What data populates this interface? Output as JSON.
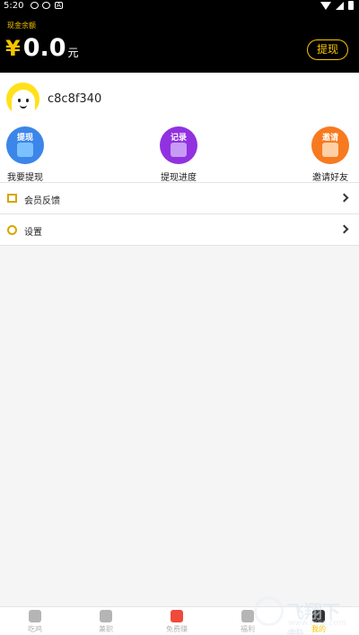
{
  "status_bar": {
    "time": "5:20",
    "notif_badge": "A"
  },
  "balance": {
    "label": "现金余额",
    "currency_symbol": "¥",
    "amount": "0.0",
    "unit": "元",
    "withdraw_label": "提现"
  },
  "profile": {
    "username": "c8c8f340"
  },
  "actions": [
    {
      "badge": "提现",
      "label": "我要提现",
      "color": "#3b86e8"
    },
    {
      "badge": "记录",
      "label": "提现进度",
      "color": "#9131e0"
    },
    {
      "badge": "邀请",
      "label": "邀请好友",
      "color": "#f77a1f"
    }
  ],
  "menu": [
    {
      "label": "会员反馈",
      "icon": "feedback-icon"
    },
    {
      "label": "设置",
      "icon": "settings-icon"
    }
  ],
  "tabs": [
    {
      "label": "吃鸡",
      "icon": "home-icon"
    },
    {
      "label": "兼职",
      "icon": "gamepad-icon"
    },
    {
      "label": "免费赚",
      "icon": "red-envelope-icon"
    },
    {
      "label": "福利",
      "icon": "gift-icon"
    },
    {
      "label": "我的",
      "icon": "profile-icon",
      "active": true
    }
  ],
  "watermark": {
    "text": "飞翔下载",
    "url": "www.fxxz.com"
  },
  "colors": {
    "accent": "#f6c400",
    "header_bg": "#000000",
    "page_bg": "#f5f5f5"
  }
}
